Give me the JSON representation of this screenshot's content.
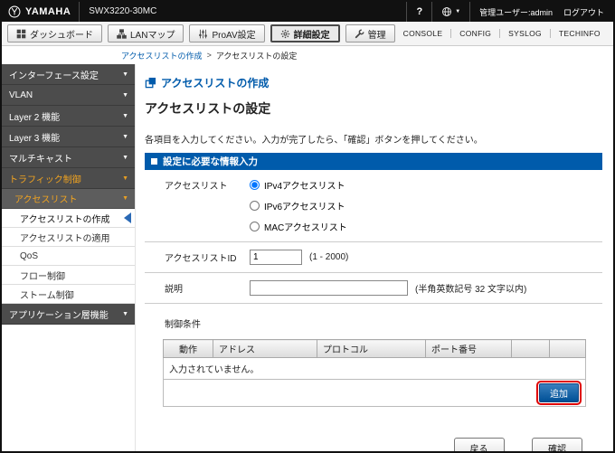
{
  "theme": {
    "accent-blue": "#005bab",
    "highlight-red": "#e00000",
    "active-orange": "#f0a321"
  },
  "topbar": {
    "brand": "YAMAHA",
    "model": "SWX3220-30MC",
    "help": "?",
    "user": "管理ユーザー:admin",
    "logout": "ログアウト",
    "caret": "▼"
  },
  "tabbar": {
    "tabs": [
      {
        "label": "ダッシュボード"
      },
      {
        "label": "LANマップ"
      },
      {
        "label": "ProAV設定"
      },
      {
        "label": "詳細設定"
      },
      {
        "label": "管理"
      }
    ],
    "links": [
      "CONSOLE",
      "CONFIG",
      "SYSLOG",
      "TECHINFO"
    ]
  },
  "breadcrumb": {
    "parent": "アクセスリストの作成",
    "separator": ">",
    "current": "アクセスリストの設定"
  },
  "sidebar": {
    "arrow": "▼",
    "items": [
      {
        "label": "インターフェース設定"
      },
      {
        "label": "VLAN"
      },
      {
        "label": "Layer 2 機能"
      },
      {
        "label": "Layer 3 機能"
      },
      {
        "label": "マルチキャスト"
      },
      {
        "label": "トラフィック制御"
      },
      {
        "label": "アクセスリスト"
      },
      {
        "label": "アクセスリストの作成"
      },
      {
        "label": "アクセスリストの適用"
      },
      {
        "label": "QoS"
      },
      {
        "label": "フロー制御"
      },
      {
        "label": "ストーム制御"
      },
      {
        "label": "アプリケーション層機能"
      }
    ]
  },
  "main": {
    "page_title": "アクセスリストの作成",
    "section_title": "アクセスリストの設定",
    "instruction": "各項目を入力してください。入力が完了したら、「確認」ボタンを押してください。",
    "panel_header": "設定に必要な情報入力",
    "form": {
      "access_list": {
        "label": "アクセスリスト",
        "options": [
          {
            "label": "IPv4アクセスリスト",
            "checked": true
          },
          {
            "label": "IPv6アクセスリスト",
            "checked": false
          },
          {
            "label": "MACアクセスリスト",
            "checked": false
          }
        ]
      },
      "access_list_id": {
        "label": "アクセスリストID",
        "value": "1",
        "hint": "(1 - 2000)"
      },
      "description": {
        "label": "説明",
        "value": "",
        "hint": "(半角英数記号 32 文字以内)"
      },
      "condition": {
        "label": "制御条件",
        "table": {
          "headers": [
            "動作",
            "アドレス",
            "プロトコル",
            "ポート番号"
          ],
          "empty_text": "入力されていません。",
          "add_label": "追加"
        }
      }
    },
    "footer_buttons": {
      "back": "戻る",
      "confirm": "確認"
    }
  }
}
